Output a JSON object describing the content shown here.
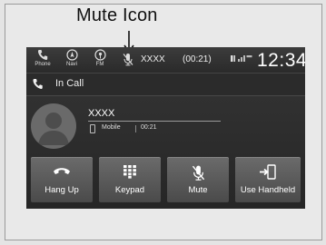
{
  "callout": {
    "label": "Mute Icon"
  },
  "status_bar": {
    "items": [
      {
        "label": "Phone",
        "icon": "phone-icon"
      },
      {
        "label": "Navi",
        "icon": "navi-icon"
      },
      {
        "label": "FM",
        "icon": "fm-icon"
      }
    ],
    "mute_indicator_icon": "microphone-muted-icon",
    "caller_name": "XXXX",
    "call_duration": "(00:21)",
    "clock": "12:34"
  },
  "call_header": {
    "text": "In Call",
    "icon": "phone-handset-icon"
  },
  "contact": {
    "name": "XXXX",
    "phone_type": "Mobile",
    "elapsed": "00:21",
    "avatar_icon": "person-avatar-icon"
  },
  "actions": [
    {
      "label": "Hang Up",
      "icon": "hang-up-icon"
    },
    {
      "label": "Keypad",
      "icon": "keypad-icon"
    },
    {
      "label": "Mute",
      "icon": "microphone-muted-icon"
    },
    {
      "label": "Use Handheld",
      "icon": "transfer-to-handset-icon"
    }
  ]
}
